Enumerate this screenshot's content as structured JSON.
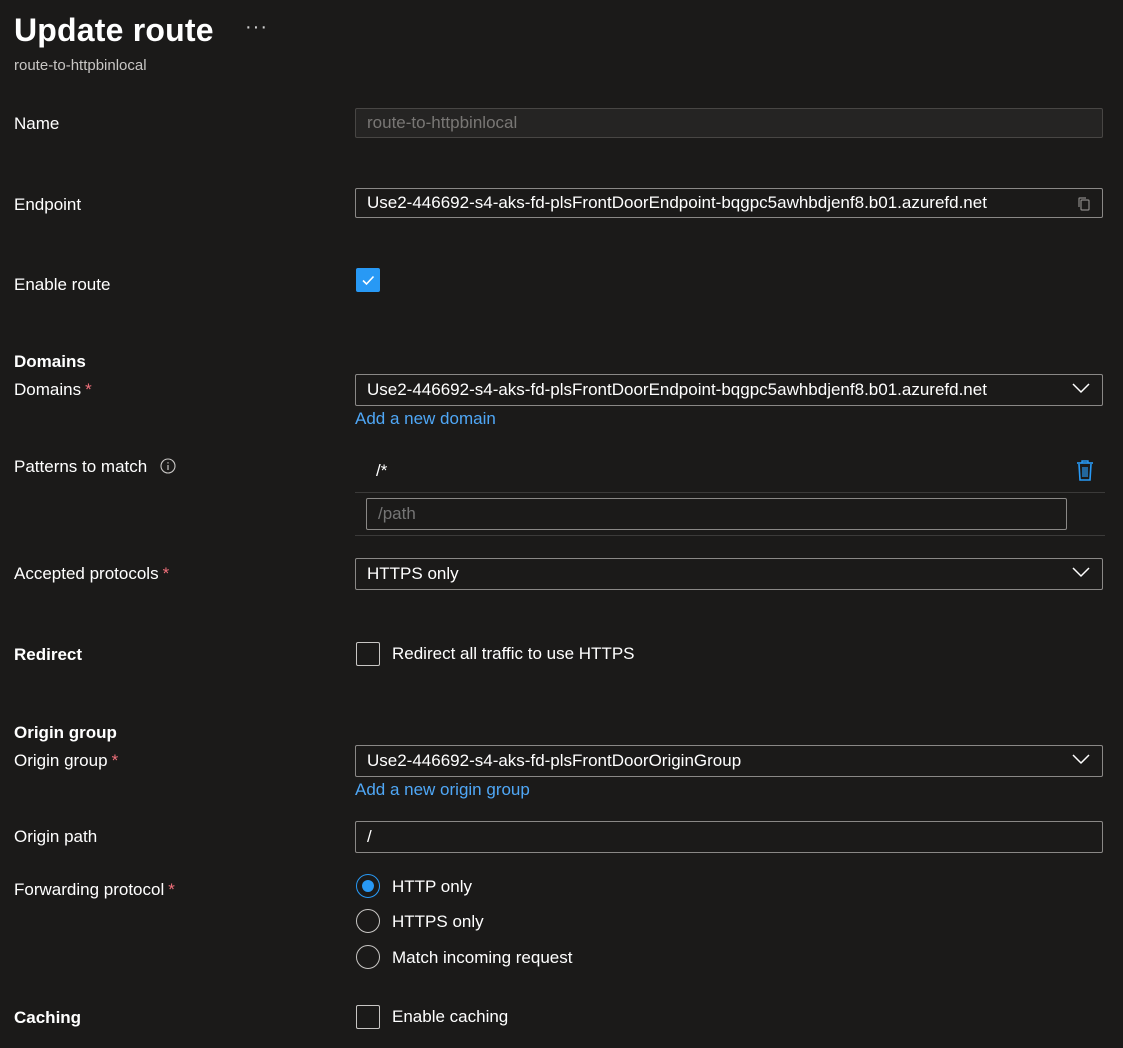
{
  "header": {
    "title": "Update route",
    "more_label": "···",
    "subtitle": "route-to-httpbinlocal"
  },
  "form": {
    "name": {
      "label": "Name",
      "value": "route-to-httpbinlocal"
    },
    "endpoint": {
      "label": "Endpoint",
      "value": "Use2-446692-s4-aks-fd-plsFrontDoorEndpoint-bqgpc5awhbdjenf8.b01.azurefd.net",
      "icon": "copy-icon"
    },
    "enable_route": {
      "label": "Enable route",
      "checked": true
    },
    "domains_section": {
      "heading": "Domains"
    },
    "domains": {
      "label": "Domains",
      "required_mark": "*",
      "selected": "Use2-446692-s4-aks-fd-plsFrontDoorEndpoint-bqgpc5awhbdjenf8.b01.azurefd.net",
      "add_link": "Add a new domain"
    },
    "patterns": {
      "label": "Patterns to match",
      "items": [
        "/*"
      ],
      "placeholder": "/path",
      "icon": "info-icon",
      "delete_icon": "trash-icon"
    },
    "accepted_protocols": {
      "label": "Accepted protocols",
      "required_mark": "*",
      "selected": "HTTPS only"
    },
    "redirect": {
      "heading": "Redirect",
      "checkbox_label": "Redirect all traffic to use HTTPS",
      "checked": false
    },
    "origin_section": {
      "heading": "Origin group"
    },
    "origin_group": {
      "label": "Origin group",
      "required_mark": "*",
      "selected": "Use2-446692-s4-aks-fd-plsFrontDoorOriginGroup",
      "add_link": "Add a new origin group"
    },
    "origin_path": {
      "label": "Origin path",
      "value": "/"
    },
    "forwarding_protocol": {
      "label": "Forwarding protocol",
      "required_mark": "*",
      "options": [
        "HTTP only",
        "HTTPS only",
        "Match incoming request"
      ],
      "selected_index": 0
    },
    "caching": {
      "heading": "Caching",
      "checkbox_label": "Enable caching",
      "checked": false
    }
  },
  "colors": {
    "background": "#1b1a19",
    "accent": "#2899f5",
    "link": "#4fa7f6",
    "required": "#f1707b",
    "border": "#8a8886"
  }
}
